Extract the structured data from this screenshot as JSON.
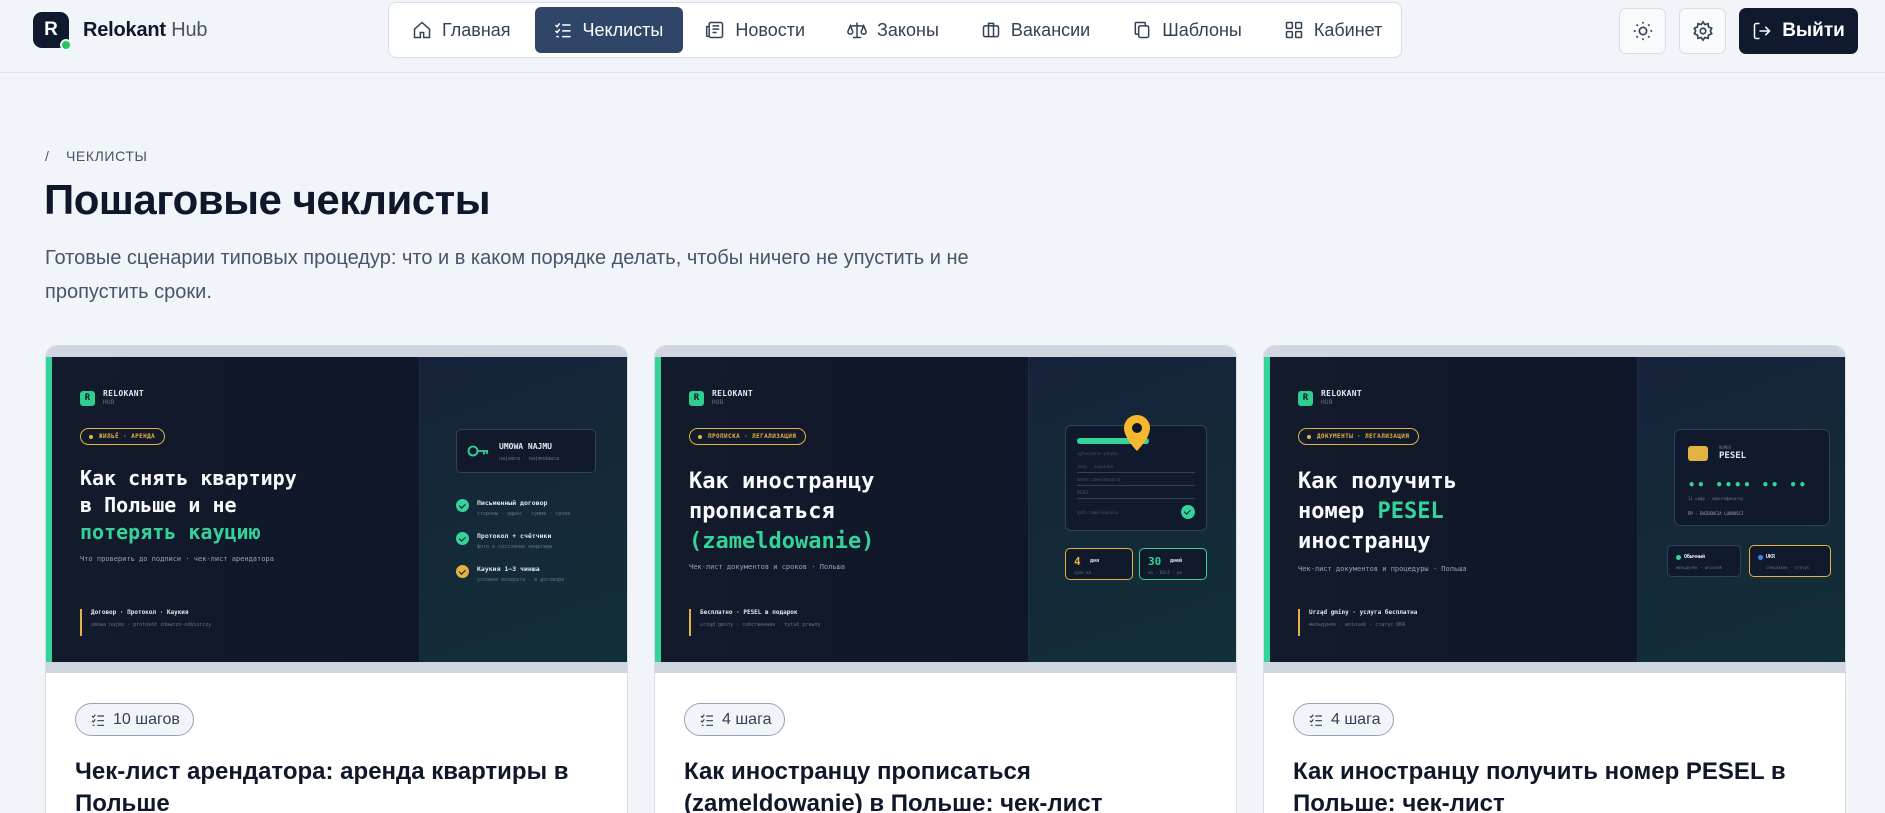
{
  "brand": {
    "letter": "R",
    "name": "Relokant",
    "suffix": "Hub"
  },
  "nav": [
    {
      "label": "Главная",
      "icon": "home-icon"
    },
    {
      "label": "Чеклисты",
      "icon": "checklist-icon",
      "active": true
    },
    {
      "label": "Новости",
      "icon": "news-icon"
    },
    {
      "label": "Законы",
      "icon": "scale-icon"
    },
    {
      "label": "Вакансии",
      "icon": "briefcase-icon"
    },
    {
      "label": "Шаблоны",
      "icon": "copy-icon"
    },
    {
      "label": "Кабинет",
      "icon": "grid-icon"
    }
  ],
  "header": {
    "theme_icon": "sun-icon",
    "settings_icon": "gear-icon",
    "logout_label": "Выйти"
  },
  "breadcrumb": {
    "separator": "/",
    "current": "ЧЕКЛИСТЫ"
  },
  "page": {
    "title": "Пошаговые чеклисты",
    "lead": "Готовые сценарии типовых процедур: что и в каком порядке делать, чтобы ничего не упустить и не пропустить сроки."
  },
  "cards": [
    {
      "steps": "10 шагов",
      "title": "Чек-лист арендатора: аренда квартиры в Польше",
      "cover": {
        "brand": "RELOKANT",
        "brand_sub": "HUB",
        "tag": "ЖИЛЬЁ · АРЕНДА",
        "title_main": "Как снять квартиру\nв Польше и не",
        "title_accent": "потерять кауцию",
        "subtitle": "Что проверить до подписи · чек-лист арендатора",
        "foot_a": "Договор · Протокол · Каукия",
        "foot_b": "umowa najmu · protokół zdawczo-odbiorczy",
        "doc_title": "UMOWA NAJMU",
        "doc_sub": "najemca · najmodawca",
        "checks": [
          {
            "a": "Письменный договор",
            "b": "стороны · адрес · сумма · сроки"
          },
          {
            "a": "Протокол + счётчики",
            "b": "фото и состояние квартиры"
          },
          {
            "a": "Каукия 1–3 чинша",
            "b": "условия возврата · в договоре"
          }
        ]
      }
    },
    {
      "steps": "4 шага",
      "title": "Как иностранцу прописаться (zameldowanie) в Польше: чек-лист",
      "cover": {
        "brand": "RELOKANT",
        "brand_sub": "HUB",
        "tag": "ПРОПИСКА · ЛЕГАЛИЗАЦИЯ",
        "title_main": "Как иностранцу\nпрописаться",
        "title_accent": "(zameldowanie)",
        "subtitle": "Чек-лист документов и сроков · Польша",
        "foot_a": "Бесплатно · PESEL в подарок",
        "foot_b": "urząd gminy · собственник · tytuł prawny",
        "form_lines": [
          "zgłoszenie pobytu",
          "imię · nazwisko",
          "adres zameldowania",
          "PESEL",
          "data zameldowania"
        ],
        "stat1_n": "4",
        "stat1_u": "дня",
        "stat1_s": "срок на",
        "stat2_n": "30",
        "stat2_u": "дней",
        "stat2_s": "на · EU/Z · на"
      }
    },
    {
      "steps": "4 шага",
      "title": "Как иностранцу получить номер PESEL в Польше: чек-лист",
      "cover": {
        "brand": "RELOKANT",
        "brand_sub": "HUB",
        "tag": "ДОКУМЕНТЫ · ЛЕГАЛИЗАЦИЯ",
        "title_pre": "Как получить\nномер ",
        "title_accent": "PESEL",
        "title_post": "\nиностранцу",
        "subtitle": "Чек-лист документов и процедуры · Польша",
        "foot_a": "Urząd gminy · услуга бесплатна",
        "foot_b": "мельдунек · wniosek · статус UKR",
        "card_label": "NUMER",
        "card_title": "PESEL",
        "card_dots": "•• •••• •• ••",
        "card_x1": "11 цифр · идентификатор",
        "card_x2": "ПР · EWIDENCJA LUDNOŚCI",
        "pill_a": "Обычный",
        "pill_a_sub": "мельдунек · wniosek",
        "pill_b": "UKR",
        "pill_b_sub": "спецзакон · статус"
      }
    }
  ]
}
